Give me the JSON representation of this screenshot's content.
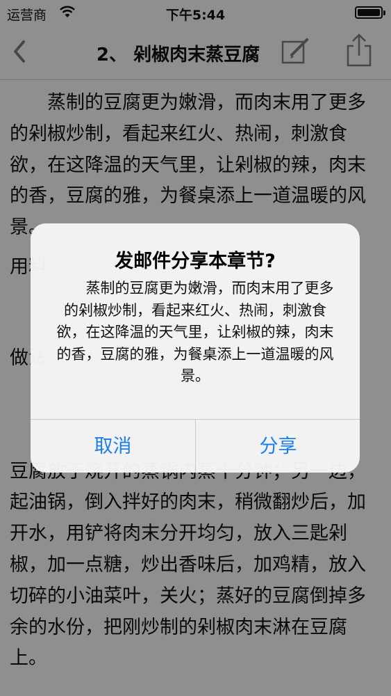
{
  "status": {
    "carrier": "运营商",
    "time": "下午5:44"
  },
  "nav": {
    "title": "2、 剁椒肉末蒸豆腐"
  },
  "content": {
    "paragraphs": [
      "蒸制的豆腐更为嫩滑，而肉末用了更多的剁椒炒制，看起来红火、热闹，刺激食欲，在这降温的天气里，让剁椒的辣，肉末的香，豆腐的雅，为餐桌添上一道温暖的风景。",
      "用料",
      "做法",
      "豆腐放于烧开的蒸锅内蒸十分钟；另一边，起油锅，倒入拌好的肉末，稍微翻炒后，加开水，用铲将肉末分开均匀，放入三匙剁椒，加一点糖，炒出香味后，加鸡精，放入切碎的小油菜叶，关火；蒸好的豆腐倒掉多余的水份，把刚炒制的剁椒肉末淋在豆腐上。"
    ]
  },
  "alert": {
    "title": "发邮件分享本章节?",
    "message": "蒸制的豆腐更为嫩滑，而肉末用了更多的剁椒炒制，看起来红火、热闹，刺激食欲，在这降温的天气里，让剁椒的辣，肉末的香，豆腐的雅，为餐桌添上一道温暖的风景。",
    "cancel_label": "取消",
    "share_label": "分享"
  },
  "colors": {
    "accent": "#1a7ef0",
    "nav_icon": "#7a7a7a"
  }
}
